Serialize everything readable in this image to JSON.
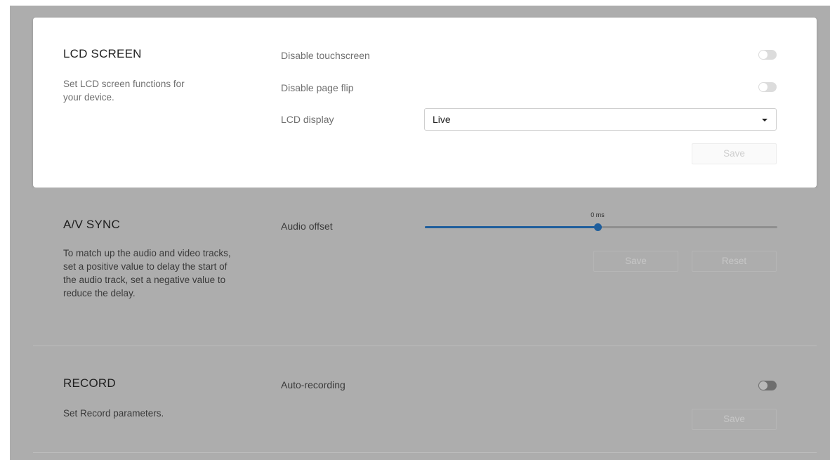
{
  "lcd": {
    "title": "LCD SCREEN",
    "description": "Set LCD screen functions for your device.",
    "disable_touchscreen": {
      "label": "Disable touchscreen",
      "enabled": false
    },
    "disable_page_flip": {
      "label": "Disable page flip",
      "enabled": false
    },
    "lcd_display": {
      "label": "LCD display",
      "value": "Live"
    },
    "save_label": "Save"
  },
  "av_sync": {
    "title": "A/V SYNC",
    "description": "To match up the audio and video tracks, set a positive value to delay the start of the audio track, set a negative value to reduce the delay.",
    "audio_offset": {
      "label": "Audio offset",
      "value_text": "0 ms",
      "value": 0,
      "position_fraction": 0.49
    },
    "save_label": "Save",
    "reset_label": "Reset"
  },
  "record": {
    "title": "RECORD",
    "description": "Set Record parameters.",
    "auto_recording": {
      "label": "Auto-recording",
      "enabled": false
    },
    "save_label": "Save"
  }
}
